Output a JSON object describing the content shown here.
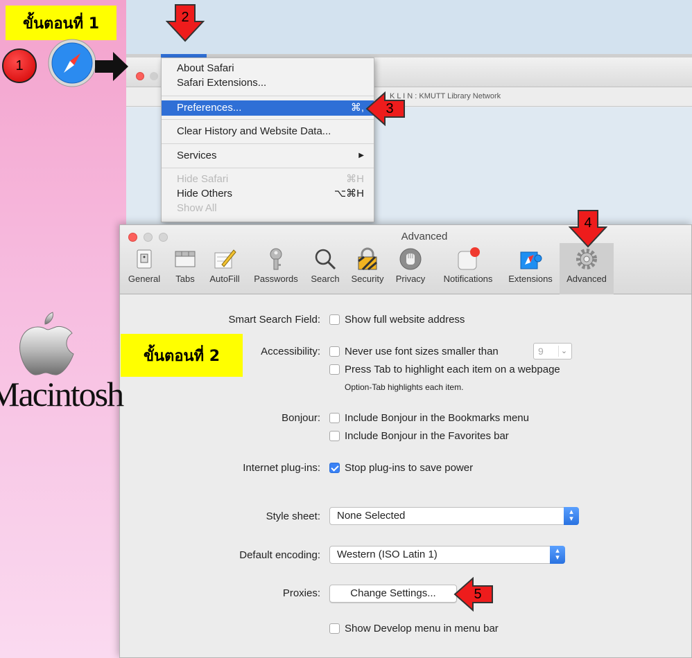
{
  "annotations": {
    "step1_label": "ขั้นตอนที่ 1",
    "step2_label": "ขั้นตอนที่ 2",
    "markers": [
      "1",
      "2",
      "3",
      "4",
      "5"
    ],
    "macintosh_text": "Macintosh",
    "marker_color": "#e00000",
    "label_color": "#ffff00"
  },
  "safari_window": {
    "tab_title": "K L I N : KMUTT Library Network"
  },
  "safari_menu": {
    "items": [
      {
        "label": "About Safari",
        "shortcut": ""
      },
      {
        "label": "Safari Extensions...",
        "shortcut": ""
      },
      {
        "label": "Preferences...",
        "shortcut": "⌘,",
        "selected": true
      },
      {
        "label": "Clear History and Website Data...",
        "shortcut": ""
      },
      {
        "label": "Services",
        "shortcut": "▶"
      },
      {
        "label": "Hide Safari",
        "shortcut": "⌘H",
        "disabled": true
      },
      {
        "label": "Hide Others",
        "shortcut": "⌥⌘H"
      },
      {
        "label": "Show All",
        "shortcut": "",
        "disabled": true
      }
    ]
  },
  "prefs": {
    "title": "Advanced",
    "tabs": [
      {
        "label": "General",
        "icon": "general-icon"
      },
      {
        "label": "Tabs",
        "icon": "tabs-icon"
      },
      {
        "label": "AutoFill",
        "icon": "autofill-icon"
      },
      {
        "label": "Passwords",
        "icon": "key-icon"
      },
      {
        "label": "Search",
        "icon": "magnifier-icon"
      },
      {
        "label": "Security",
        "icon": "lock-icon"
      },
      {
        "label": "Privacy",
        "icon": "hand-icon"
      },
      {
        "label": "Notifications",
        "icon": "notification-icon"
      },
      {
        "label": "Extensions",
        "icon": "puzzle-icon"
      },
      {
        "label": "Advanced",
        "icon": "gear-icon",
        "active": true
      }
    ],
    "smart_search": {
      "label": "Smart Search Field:",
      "option": "Show full website address",
      "checked": false
    },
    "accessibility": {
      "label": "Accessibility:",
      "font_option": "Never use font sizes smaller than",
      "font_size": "9",
      "tab_option": "Press Tab to highlight each item on a webpage",
      "hint": "Option-Tab highlights each item."
    },
    "bonjour": {
      "label": "Bonjour:",
      "bookmarks_option": "Include Bonjour in the Bookmarks menu",
      "favorites_option": "Include Bonjour in the Favorites bar"
    },
    "plugins": {
      "label": "Internet plug-ins:",
      "option": "Stop plug-ins to save power",
      "checked": true
    },
    "style_sheet": {
      "label": "Style sheet:",
      "value": "None Selected"
    },
    "encoding": {
      "label": "Default encoding:",
      "value": "Western (ISO Latin 1)"
    },
    "proxies": {
      "label": "Proxies:",
      "button": "Change Settings..."
    },
    "develop": {
      "option": "Show Develop menu in menu bar",
      "checked": false
    }
  }
}
